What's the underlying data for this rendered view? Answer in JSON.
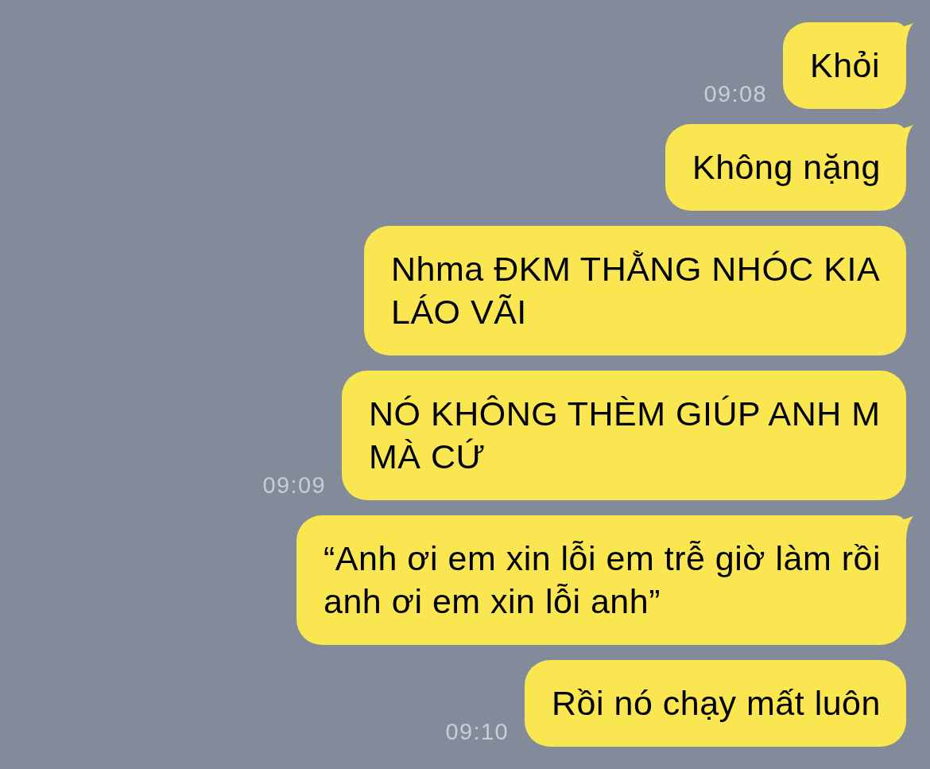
{
  "messages": [
    {
      "text": "Khỏi",
      "time": "09:08",
      "tail": true
    },
    {
      "text": "Không nặng",
      "tail": true
    },
    {
      "text": "Nhma ĐKM THẰNG NHÓC KIA LÁO VÃI",
      "tail": false
    },
    {
      "text": "NÓ KHÔNG THÈM GIÚP ANH M MÀ CỨ",
      "time": "09:09",
      "tail": false
    },
    {
      "text": "“Anh ơi em xin lỗi em trễ giờ làm rồi anh ơi em xin lỗi anh”",
      "tail": true
    },
    {
      "text": "Rồi nó chạy mất luôn",
      "time": "09:10",
      "tail": false
    }
  ]
}
